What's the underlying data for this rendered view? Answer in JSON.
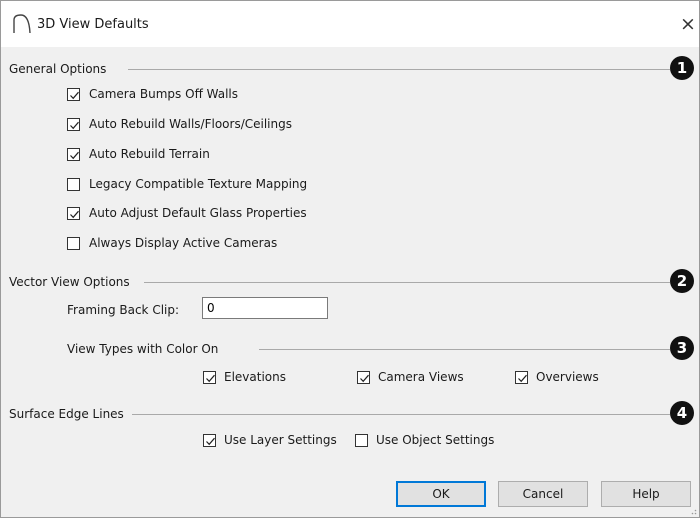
{
  "dialog": {
    "title": "3D View Defaults",
    "close_glyph": "×"
  },
  "general": {
    "label": "General Options",
    "badge": "1",
    "items": [
      {
        "label": "Camera Bumps Off Walls",
        "checked": true
      },
      {
        "label": "Auto Rebuild Walls/Floors/Ceilings",
        "checked": true
      },
      {
        "label": "Auto Rebuild Terrain",
        "checked": true
      },
      {
        "label": "Legacy Compatible Texture Mapping",
        "checked": false
      },
      {
        "label": "Auto Adjust Default Glass Properties",
        "checked": true
      },
      {
        "label": "Always Display Active Cameras",
        "checked": false
      }
    ]
  },
  "vector": {
    "label": "Vector View Options",
    "badge": "2",
    "framing_label": "Framing Back Clip:",
    "framing_value": "0",
    "color_label": "View Types with Color On",
    "color_badge": "3",
    "color_items": [
      {
        "label": "Elevations",
        "checked": true
      },
      {
        "label": "Camera Views",
        "checked": true
      },
      {
        "label": "Overviews",
        "checked": true
      }
    ]
  },
  "surface": {
    "label": "Surface Edge Lines",
    "badge": "4",
    "items": [
      {
        "label": "Use Layer Settings",
        "checked": true
      },
      {
        "label": "Use Object Settings",
        "checked": false
      }
    ]
  },
  "buttons": {
    "ok": "OK",
    "cancel": "Cancel",
    "help": "Help"
  },
  "icons": {
    "title": "arch-icon",
    "close": "close-icon",
    "check": "checkmark-icon",
    "grip": "resize-grip-icon"
  }
}
